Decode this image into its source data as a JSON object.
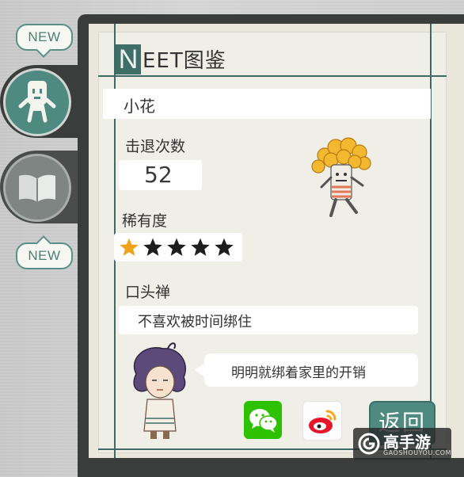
{
  "tabs": {
    "badge_top": "NEW",
    "badge_bottom": "NEW"
  },
  "card": {
    "title_initial": "N",
    "title_rest": "EET图鉴",
    "name": "小花",
    "kills_label": "击退次数",
    "kills_value": "52",
    "rarity_label": "稀有度",
    "rarity_stars": 1,
    "rarity_max": 5,
    "catchphrase_label": "口头禅",
    "catchphrase": "不喜欢被时间绑住",
    "speech": "明明就绑着家里的开销",
    "back_label": "返回"
  },
  "watermark": {
    "name": "高手游",
    "domain": "GAOSHOUYOU.COM"
  },
  "colors": {
    "accent": "#4f8a80",
    "frame": "#3a3d3c",
    "star_on": "#f0a21b",
    "star_off": "#1d1d1d",
    "wechat": "#2dc100",
    "weibo": "#e6162d"
  }
}
